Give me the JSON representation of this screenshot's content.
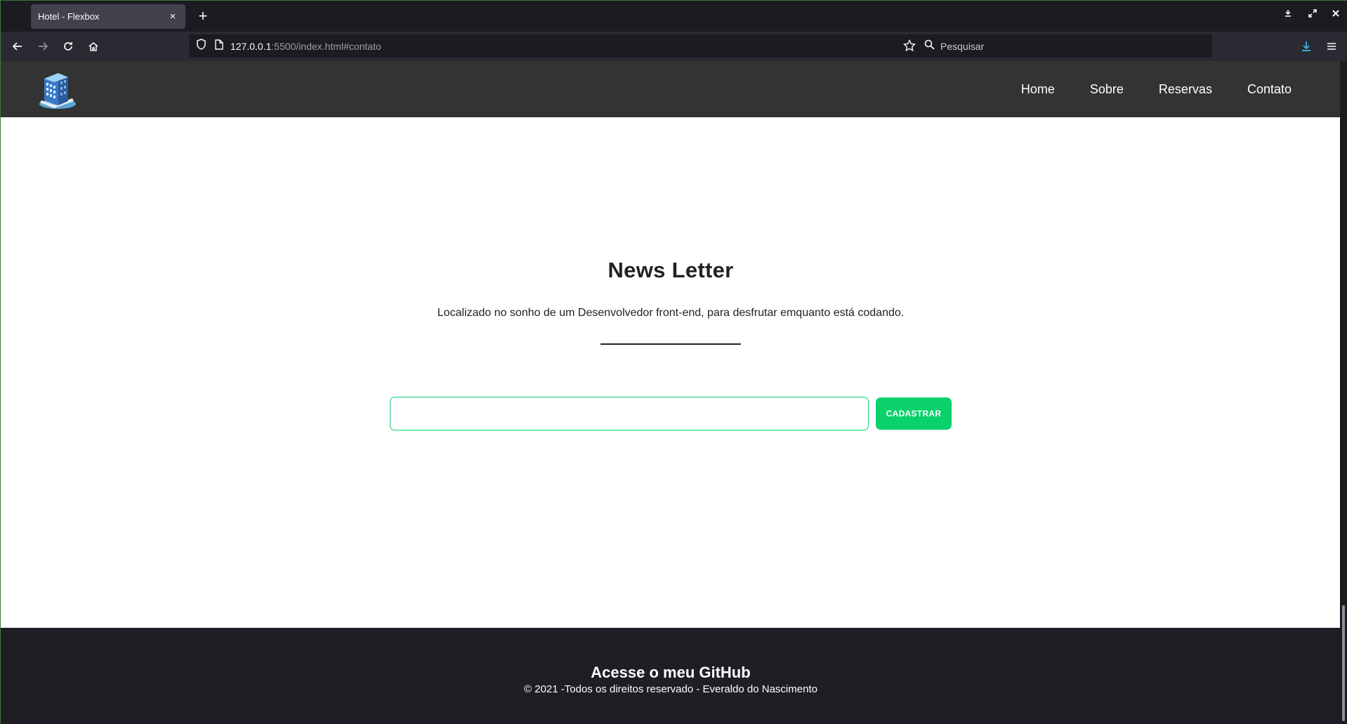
{
  "browser": {
    "tab_title": "Hotel - Flexbox",
    "tab_close": "×",
    "new_tab": "+",
    "url_host": "127.0.0.1",
    "url_rest": ":5500/index.html#contato",
    "search_placeholder": "Pesquisar",
    "accent_color": "#0bd16a"
  },
  "site": {
    "nav": [
      "Home",
      "Sobre",
      "Reservas",
      "Contato"
    ]
  },
  "newsletter": {
    "title": "News Letter",
    "description": "Localizado no sonho de um Desenvolvedor front-end, para desfrutar emquanto está codando.",
    "email_value": "",
    "submit_label": "CADASTRAR"
  },
  "footer": {
    "title": "Acesse o meu GitHub",
    "copyright": "© 2021 -Todos os direitos reservado - Everaldo do Nascimento"
  }
}
